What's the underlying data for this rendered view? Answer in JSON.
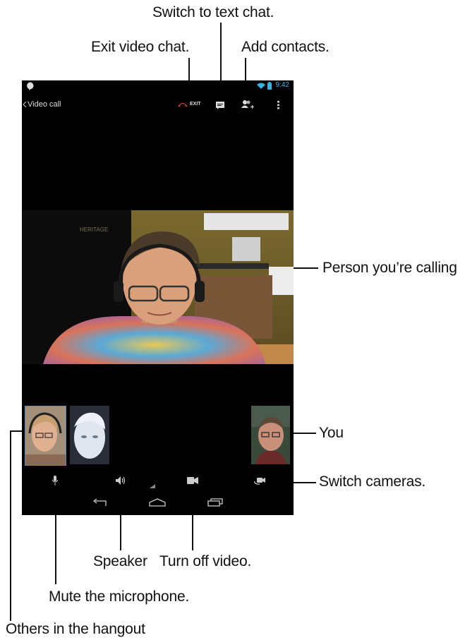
{
  "callouts": {
    "switch_text": "Switch to text chat.",
    "exit_video": "Exit video chat.",
    "add_contacts": "Add contacts.",
    "person_calling": "Person you’re calling",
    "you": "You",
    "switch_cameras": "Switch cameras.",
    "speaker": "Speaker",
    "turn_off_video": "Turn off video.",
    "mute_mic": "Mute the microphone.",
    "others": "Others in the hangout"
  },
  "status_bar": {
    "time": "9:42"
  },
  "action_bar": {
    "back_label": "Video call",
    "exit_label": "EXIT"
  },
  "colors": {
    "accent": "#33b5e5",
    "exit_red": "#e3342f",
    "screen_bg": "#000000"
  },
  "icons": [
    "hangouts-icon",
    "wifi-icon",
    "battery-icon",
    "back-chevron-icon",
    "phone-hangup-icon",
    "chat-icon",
    "add-person-icon",
    "overflow-menu-icon",
    "microphone-icon",
    "speaker-icon",
    "video-camera-icon",
    "switch-camera-icon",
    "nav-back-icon",
    "nav-home-icon",
    "nav-recents-icon"
  ]
}
